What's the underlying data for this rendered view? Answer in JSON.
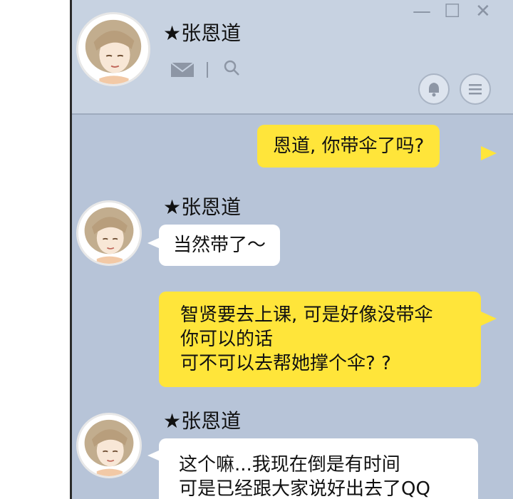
{
  "window": {
    "minimize_glyph": "—",
    "maximize_glyph": "☐",
    "close_glyph": "✕"
  },
  "header": {
    "contact_name": "★张恩道",
    "mail_icon": "mail-icon",
    "search_icon": "search-icon",
    "bell_icon": "bell-icon",
    "menu_icon": "menu-icon"
  },
  "messages": [
    {
      "sender": "me",
      "lines": [
        "恩道, 你带伞了吗?"
      ]
    },
    {
      "sender": "them",
      "name": "★张恩道",
      "lines": [
        "当然带了～"
      ]
    },
    {
      "sender": "me",
      "lines": [
        "智贤要去上课, 可是好像没带伞",
        "你可以的话",
        "可不可以去帮她撑个伞? ?"
      ]
    },
    {
      "sender": "them",
      "name": "★张恩道",
      "lines": [
        "这个嘛...我现在倒是有时间",
        "可是已经跟大家说好出去了QQ"
      ]
    }
  ],
  "colors": {
    "chat_bg": "#b7c4d8",
    "header_bg": "#c7d2e1",
    "my_bubble": "#ffe53a",
    "their_bubble": "#ffffff",
    "window_border": "#2b2b2b"
  }
}
